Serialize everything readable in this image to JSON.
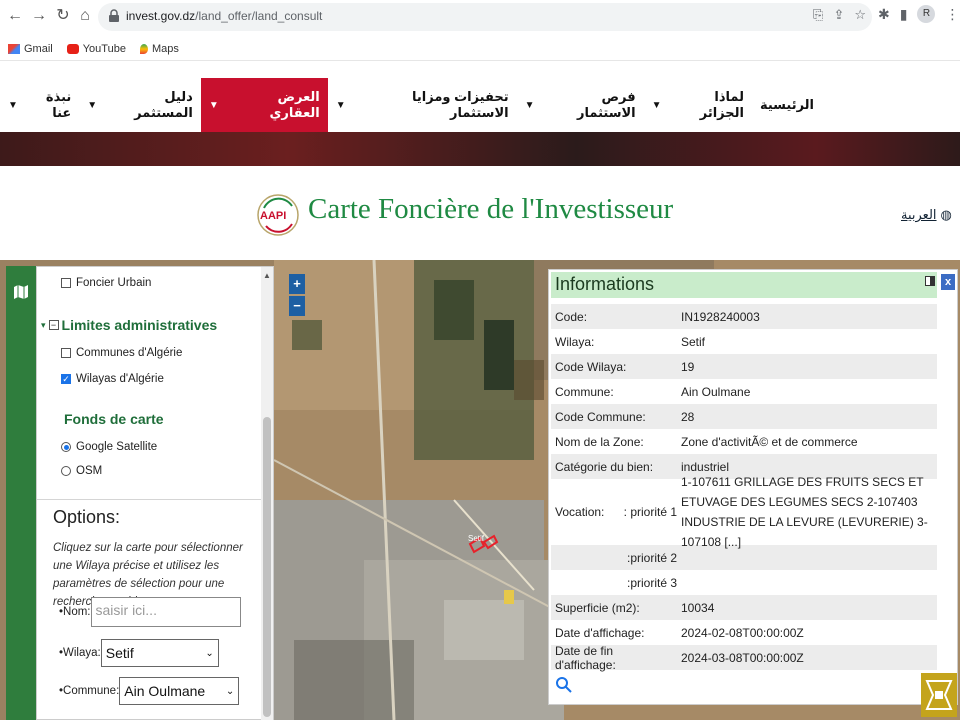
{
  "browser": {
    "url_domain": "invest.gov.dz",
    "url_path": "/land_offer/land_consult",
    "avatar_letter": "R",
    "bookmarks": [
      "Gmail",
      "YouTube",
      "Maps"
    ]
  },
  "site_nav": {
    "items": [
      "الرئيسية",
      "لماذا الجزائر",
      "فرص الاستثمار",
      "تحفيزات ومزايا الاستثمار",
      "العرض العقاري",
      "دليل المستثمر",
      "نبذة عنا"
    ],
    "caret": "▼"
  },
  "header": {
    "logo_text": "AAPI",
    "title": "Carte Foncière de l'Investisseur",
    "lang_link": "العربية"
  },
  "panel": {
    "foncier_urbain": "Foncier Urbain",
    "limites_title": "Limites administratives",
    "communes": "Communes d'Algérie",
    "wilayas": "Wilayas d'Algérie",
    "fonds_title": "Fonds de carte",
    "google_satellite": "Google Satellite",
    "osm": "OSM",
    "options_title": "Options:",
    "options_desc": "Cliquez sur la carte pour sélectionner une Wilaya précise et utilisez les paramètres de sélection pour une rechercher rapide :",
    "nom_label": "•Nom:",
    "nom_placeholder": "saisir ici...",
    "wilaya_label": "•Wilaya:",
    "wilaya_value": "Setif",
    "commune_label": "•Commune:",
    "commune_value": "Ain Oulmane"
  },
  "map": {
    "zoom_in": "+",
    "zoom_out": "−",
    "marker_label": "Setif"
  },
  "info": {
    "title": "Informations",
    "close": "x",
    "rows": [
      {
        "label": "Code:",
        "value": "IN1928240003"
      },
      {
        "label": "Wilaya:",
        "value": "Setif"
      },
      {
        "label": "Code Wilaya:",
        "value": "19"
      },
      {
        "label": "Commune:",
        "value": "Ain Oulmane"
      },
      {
        "label": "Code Commune:",
        "value": "28"
      },
      {
        "label": "Nom de la Zone:",
        "value": "Zone d'activitÃ© et de commerce"
      },
      {
        "label": "Catégorie du bien:",
        "value": "industriel"
      },
      {
        "label": "Vocation:",
        "sublabel": "priorité 1 :",
        "value": "1-107611 GRILLAGE DES FRUITS SECS ET ETUVAGE DES LEGUMES SECS 2-107403 INDUSTRIE DE LA LEVURE (LEVURERIE) 3-107108 [...]"
      },
      {
        "label": "",
        "sublabel": "priorité 2:",
        "value": ""
      },
      {
        "label": "",
        "sublabel": "priorité 3:",
        "value": ""
      },
      {
        "label": "Superficie (m2):",
        "value": "10034"
      },
      {
        "label": "Date d'affichage:",
        "value": "2024-02-08T00:00:00Z"
      },
      {
        "label": "Date de fin d'affichage:",
        "value": "2024-03-08T00:00:00Z"
      }
    ]
  },
  "colors": {
    "nav_active": "#c8102e",
    "title_green": "#1f8a43",
    "info_header": "#c9eccb",
    "side_strip": "#2f7d3d",
    "zoom_btn": "#1d5fa3"
  }
}
